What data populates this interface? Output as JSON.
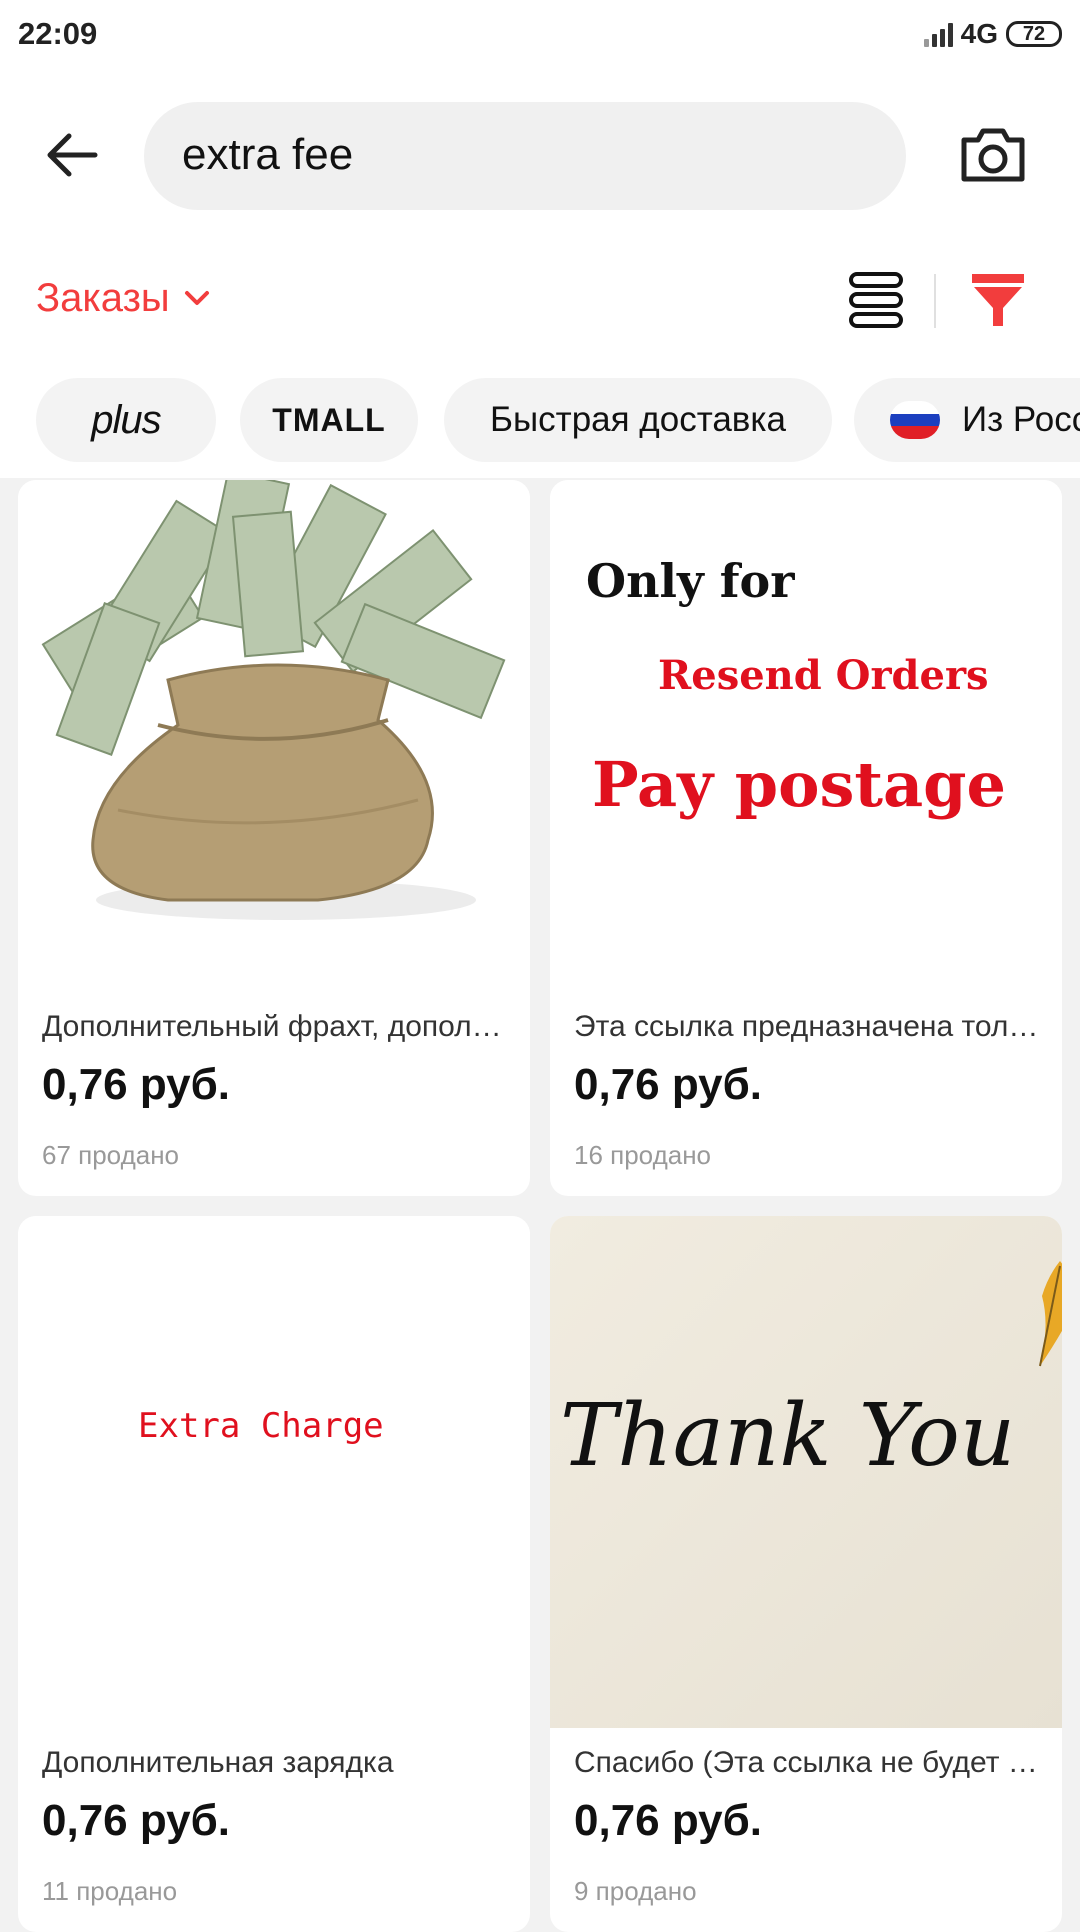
{
  "status_bar": {
    "time": "22:09",
    "network": "4G",
    "battery": "72"
  },
  "search": {
    "query": "extra fee"
  },
  "sort": {
    "label": "Заказы"
  },
  "chips": [
    {
      "label": "plus"
    },
    {
      "label": "TMALL"
    },
    {
      "label": "Быстрая доставка"
    },
    {
      "label": "Из России"
    }
  ],
  "products": [
    {
      "title": "Дополнительный фрахт, дополнительная плата",
      "price": "0,76 руб.",
      "sold": "67 продано"
    },
    {
      "title": "Эта ссылка предназначена только для",
      "price": "0,76 руб.",
      "sold": "16 продано",
      "image_text": [
        "Only for",
        "Resend Orders",
        "Pay postage"
      ]
    },
    {
      "title": "Дополнительная зарядка",
      "price": "0,76 руб.",
      "sold": "11 продано",
      "image_text": [
        "Extra Charge"
      ]
    },
    {
      "title": "Спасибо (Эта ссылка не будет отправлена)",
      "price": "0,76 руб.",
      "sold": "9 продано",
      "image_text": [
        "Thank You"
      ]
    }
  ],
  "colors": {
    "accent": "#f23d3d",
    "background": "#f2f2f2"
  },
  "icons": [
    "back-arrow-icon",
    "camera-icon",
    "chevron-down-icon",
    "list-view-icon",
    "filter-icon",
    "russia-flag-icon"
  ]
}
